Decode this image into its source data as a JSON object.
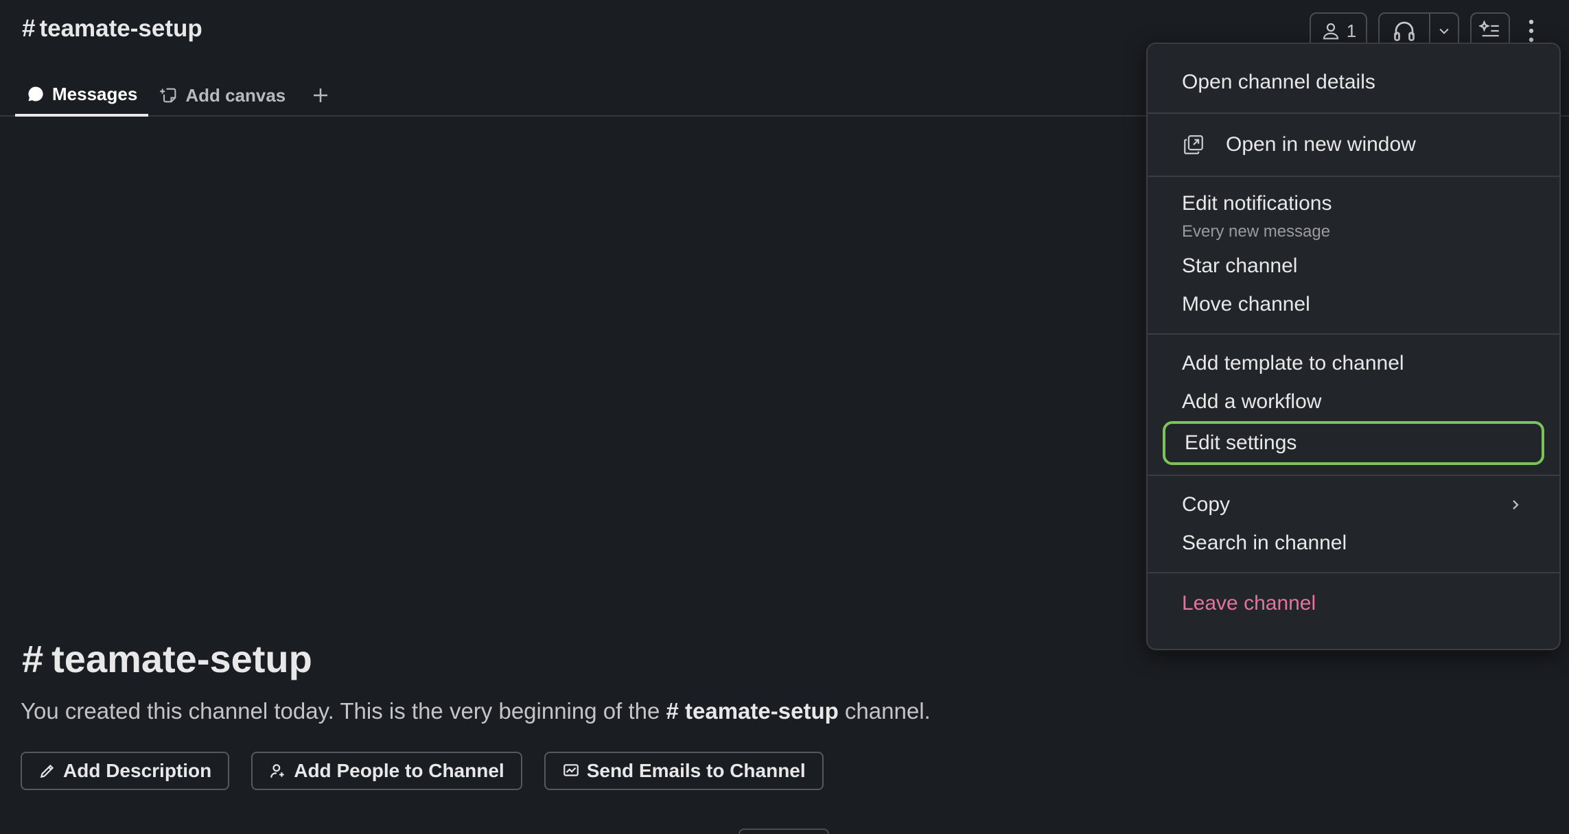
{
  "header": {
    "hash": "#",
    "channel_name": "teamate-setup",
    "members_count": "1",
    "tabs": [
      {
        "label": "Messages",
        "icon": "message-bubble-icon",
        "active": true
      },
      {
        "label": "Add canvas",
        "icon": "canvas-icon",
        "active": false
      }
    ]
  },
  "menu": {
    "open_details": "Open channel details",
    "open_new_window": "Open in new window",
    "edit_notifications": "Edit notifications",
    "notifications_value": "Every new message",
    "star_channel": "Star channel",
    "move_channel": "Move channel",
    "add_template": "Add template to channel",
    "add_workflow": "Add a workflow",
    "edit_settings": "Edit settings",
    "copy": "Copy",
    "search_in_channel": "Search in channel",
    "leave_channel": "Leave channel"
  },
  "intro": {
    "hash": "#",
    "title": "teamate-setup",
    "text_before": "You created this channel today. This is the very beginning of the ",
    "text_channel": "# teamate-setup",
    "text_after": " channel.",
    "buttons": {
      "add_description": "Add Description",
      "add_people": "Add People to Channel",
      "send_emails": "Send Emails to Channel"
    }
  },
  "colors": {
    "background": "#1a1d21",
    "menu_background": "#222529",
    "highlight_border": "#7cc35a",
    "danger_text": "#e5739b"
  }
}
